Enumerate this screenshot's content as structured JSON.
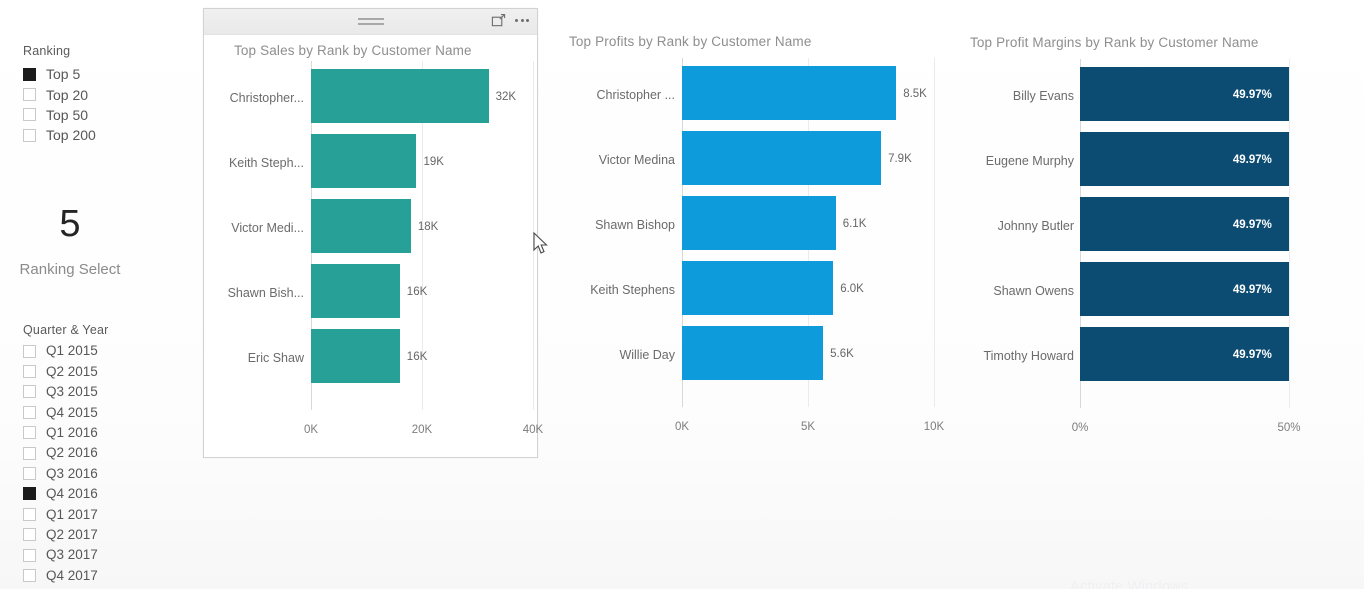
{
  "sidebar": {
    "ranking_slicer": {
      "title": "Ranking",
      "items": [
        {
          "label": "Top 5",
          "selected": true
        },
        {
          "label": "Top 20",
          "selected": false
        },
        {
          "label": "Top 50",
          "selected": false
        },
        {
          "label": "Top 200",
          "selected": false
        }
      ]
    },
    "ranking_card": {
      "value": "5",
      "caption": "Ranking Select"
    },
    "quarter_slicer": {
      "title": "Quarter & Year",
      "items": [
        {
          "label": "Q1 2015",
          "selected": false
        },
        {
          "label": "Q2 2015",
          "selected": false
        },
        {
          "label": "Q3 2015",
          "selected": false
        },
        {
          "label": "Q4 2015",
          "selected": false
        },
        {
          "label": "Q1 2016",
          "selected": false
        },
        {
          "label": "Q2 2016",
          "selected": false
        },
        {
          "label": "Q3 2016",
          "selected": false
        },
        {
          "label": "Q4 2016",
          "selected": true
        },
        {
          "label": "Q1 2017",
          "selected": false
        },
        {
          "label": "Q2 2017",
          "selected": false
        },
        {
          "label": "Q3 2017",
          "selected": false
        },
        {
          "label": "Q4 2017",
          "selected": false
        }
      ]
    }
  },
  "panels": {
    "sales": {
      "selected": true,
      "header": {
        "drag_handle": "drag-handle-icon",
        "focus_mode": "focus-mode-icon",
        "more_options": "more-options-icon"
      }
    }
  },
  "watermark": "Activate Windows",
  "chart_data": [
    {
      "type": "bar",
      "id": "sales",
      "title": "Top Sales by Rank by Customer Name",
      "orientation": "horizontal",
      "categories": [
        "Christopher...",
        "Keith Steph...",
        "Victor Medi...",
        "Shawn Bish...",
        "Eric Shaw"
      ],
      "values": [
        32000,
        19000,
        18000,
        16000,
        16000
      ],
      "data_labels": [
        "32K",
        "19K",
        "18K",
        "16K",
        "16K"
      ],
      "label_position": "outside",
      "xlabel": "",
      "ylabel": "",
      "xlim": [
        0,
        40000
      ],
      "ticks": [
        0,
        20000,
        40000
      ],
      "tick_labels": [
        "0K",
        "20K",
        "40K"
      ],
      "grid": true,
      "color": "#27a098",
      "legend": "none"
    },
    {
      "type": "bar",
      "id": "profits",
      "title": "Top Profits by Rank by Customer Name",
      "orientation": "horizontal",
      "categories": [
        "Christopher ...",
        "Victor Medina",
        "Shawn Bishop",
        "Keith Stephens",
        "Willie Day"
      ],
      "values": [
        8500,
        7900,
        6100,
        6000,
        5600
      ],
      "data_labels": [
        "8.5K",
        "7.9K",
        "6.1K",
        "6.0K",
        "5.6K"
      ],
      "label_position": "outside",
      "xlabel": "",
      "ylabel": "",
      "xlim": [
        0,
        10000
      ],
      "ticks": [
        0,
        5000,
        10000
      ],
      "tick_labels": [
        "0K",
        "5K",
        "10K"
      ],
      "grid": true,
      "color": "#0d9bdb",
      "legend": "none"
    },
    {
      "type": "bar",
      "id": "margins",
      "title": "Top Profit Margins by Rank by Customer Name",
      "orientation": "horizontal",
      "categories": [
        "Billy Evans",
        "Eugene Murphy",
        "Johnny Butler",
        "Shawn Owens",
        "Timothy Howard"
      ],
      "values": [
        49.97,
        49.97,
        49.97,
        49.97,
        49.97
      ],
      "data_labels": [
        "49.97%",
        "49.97%",
        "49.97%",
        "49.97%",
        "49.97%"
      ],
      "label_position": "inside-end",
      "xlabel": "",
      "ylabel": "",
      "xlim": [
        0,
        50
      ],
      "ticks": [
        0,
        50
      ],
      "tick_labels": [
        "0%",
        "50%"
      ],
      "grid": true,
      "color": "#0d4c72",
      "legend": "none"
    }
  ]
}
